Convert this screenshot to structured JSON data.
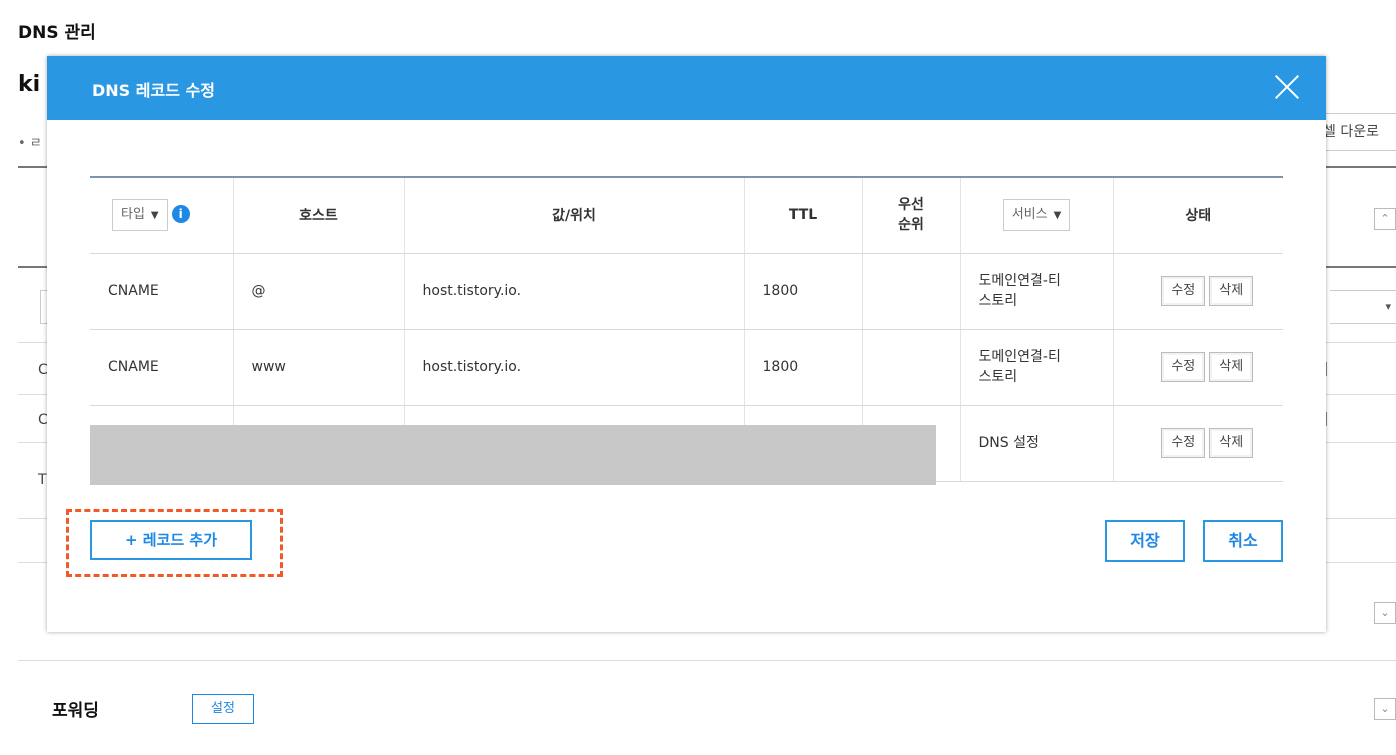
{
  "page": {
    "title": "DNS 관리",
    "domain_partial": "ki",
    "bullet_partial": "• ㄹ",
    "excel_download_partial": "셀 다운로",
    "row_letters": [
      "C",
      "C",
      "T"
    ],
    "forwarding_label": "포워딩",
    "forwarding_button": "설정"
  },
  "modal": {
    "title": "DNS 레코드 수정",
    "columns": {
      "type_select": "타입",
      "info_icon": "i",
      "host": "호스트",
      "value": "값/위치",
      "ttl": "TTL",
      "priority_line1": "우선",
      "priority_line2": "순위",
      "service_select": "서비스",
      "state": "상태"
    },
    "records": [
      {
        "type": "CNAME",
        "host": "@",
        "value": "host.tistory.io.",
        "ttl": "1800",
        "priority": "",
        "service_line1": "도메인연결-티",
        "service_line2": "스토리",
        "edit": "수정",
        "delete": "삭제"
      },
      {
        "type": "CNAME",
        "host": "www",
        "value": "host.tistory.io.",
        "ttl": "1800",
        "priority": "",
        "service_line1": "도메인연결-티",
        "service_line2": "스토리",
        "edit": "수정",
        "delete": "삭제"
      },
      {
        "type": "",
        "host": "",
        "value": "",
        "ttl": "",
        "priority": "",
        "service_line1": "DNS 설정",
        "service_line2": "",
        "edit": "수정",
        "delete": "삭제"
      }
    ],
    "add_record_label": "+ 레코드 추가",
    "save_label": "저장",
    "cancel_label": "취소"
  },
  "colors": {
    "header_blue": "#2a97e3",
    "button_blue": "#1e88e5",
    "highlight_dashed": "#f05a28",
    "mask_gray": "#c8c8c8"
  },
  "icons": {
    "close": "close-icon",
    "info": "info-icon",
    "chevron": "chevron-down-icon"
  }
}
